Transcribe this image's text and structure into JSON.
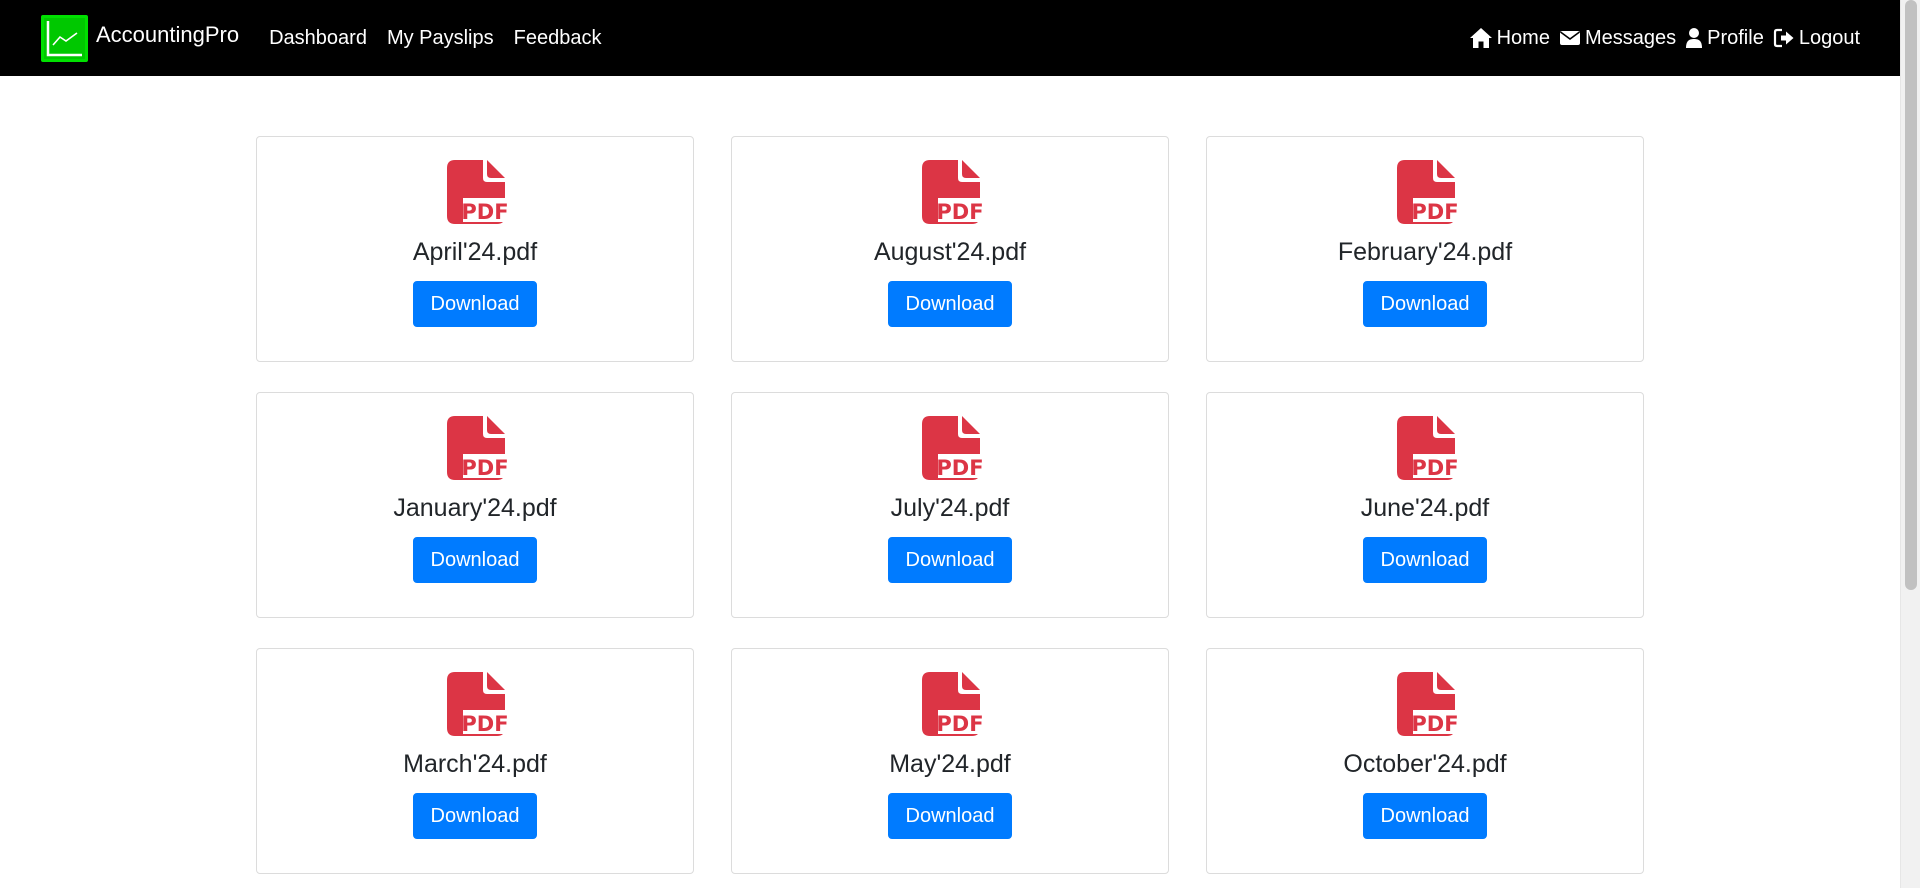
{
  "colors": {
    "navbar_bg": "#000000",
    "brand_accent": "#00c800",
    "pdf_icon": "#dc3545",
    "primary_button": "#007bff"
  },
  "navbar": {
    "brand": "AccountingPro",
    "brand_icon": "line-chart-icon",
    "links": [
      "Dashboard",
      "My Payslips",
      "Feedback"
    ],
    "right_links": [
      {
        "label": "Home",
        "icon": "home-icon"
      },
      {
        "label": "Messages",
        "icon": "envelope-icon"
      },
      {
        "label": "Profile",
        "icon": "user-icon"
      },
      {
        "label": "Logout",
        "icon": "logout-icon"
      }
    ]
  },
  "payslips": {
    "icon": "file-pdf-icon",
    "download_label": "Download",
    "files": [
      "April'24.pdf",
      "August'24.pdf",
      "February'24.pdf",
      "January'24.pdf",
      "July'24.pdf",
      "June'24.pdf",
      "March'24.pdf",
      "May'24.pdf",
      "October'24.pdf"
    ]
  }
}
